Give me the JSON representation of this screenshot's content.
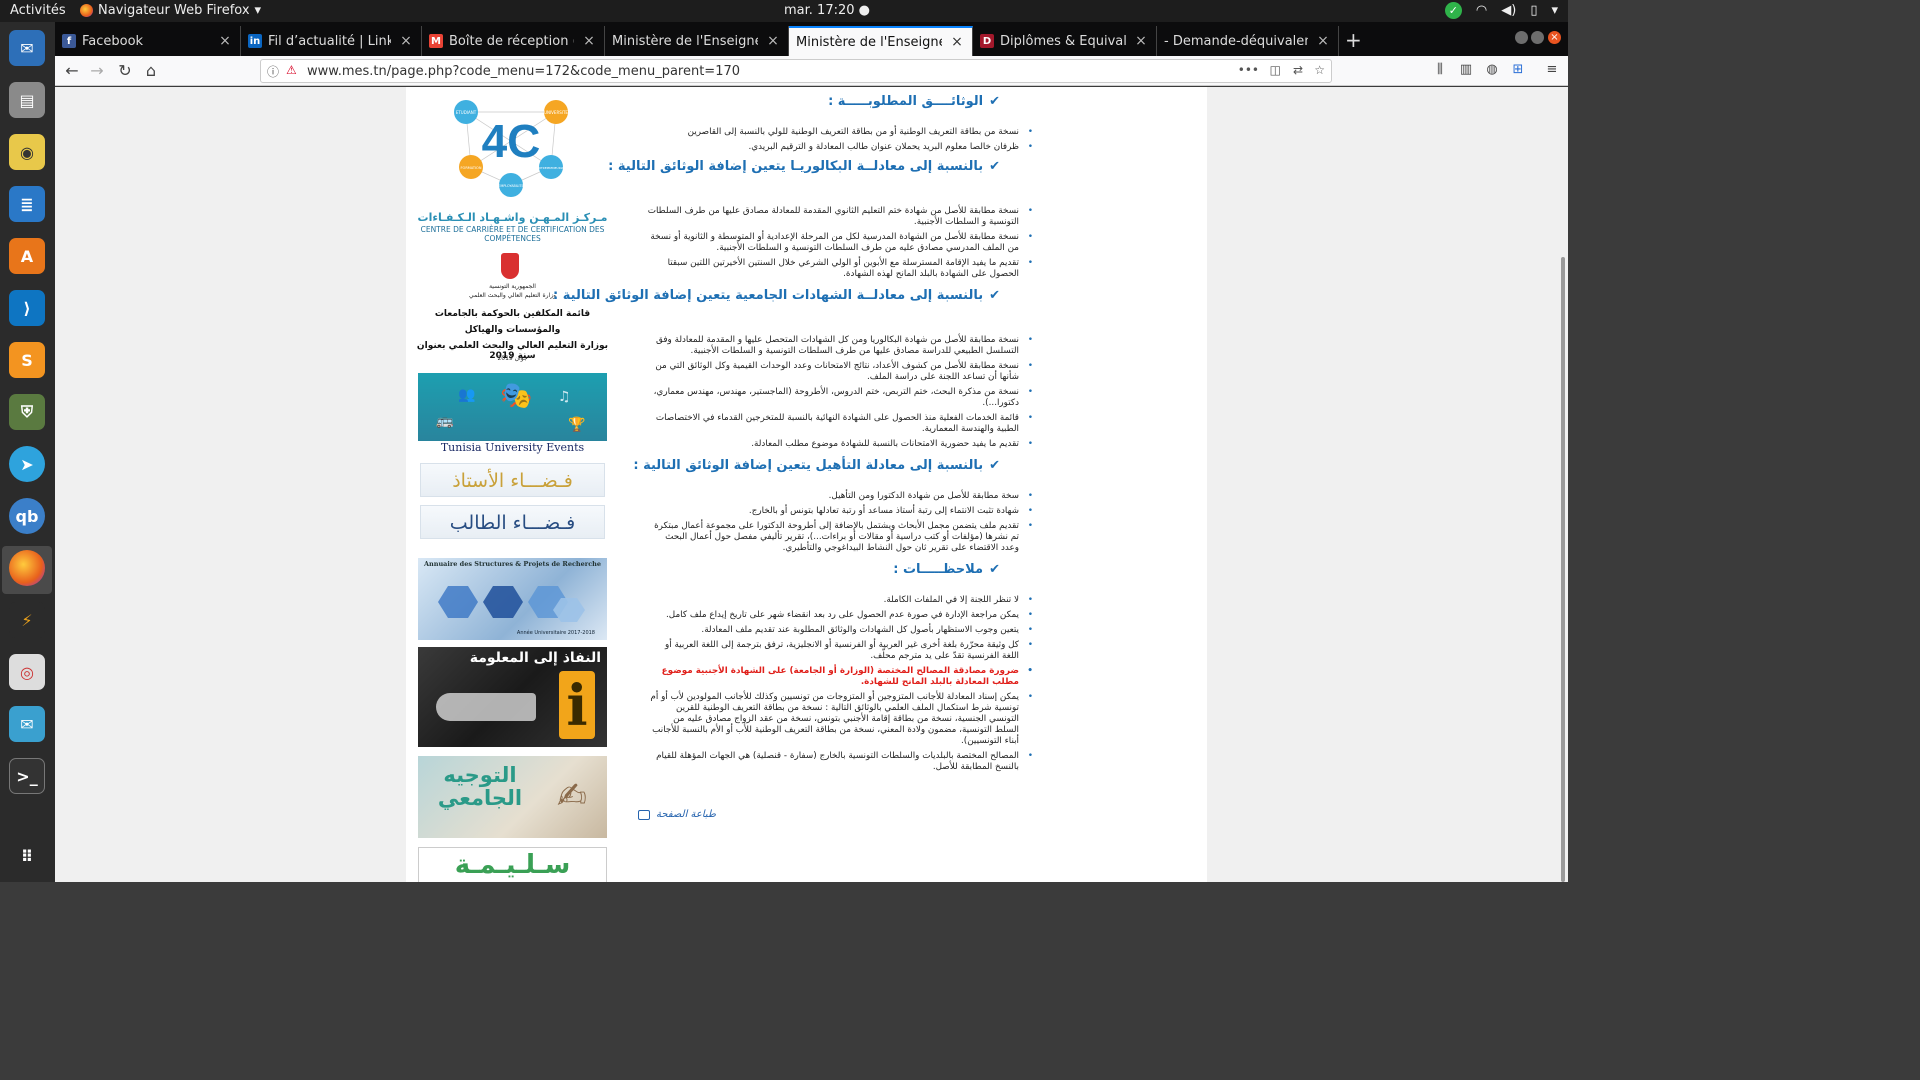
{
  "topbar": {
    "activities": "Activités",
    "app_name": "Navigateur Web Firefox",
    "clock": "mar. 17:20 ●"
  },
  "dock": {
    "items": [
      "thunderbird-icon",
      "files-icon",
      "rhythmbox-icon",
      "writer-icon",
      "software-icon",
      "vscode-icon",
      "sublime-icon",
      "app-icon",
      "telegram-icon",
      "qbittorrent-icon",
      "firefox-icon",
      "filezilla-icon",
      "evince-icon",
      "mail-icon",
      "terminal-icon",
      "apps-grid-icon"
    ]
  },
  "tabs": [
    {
      "label": "Facebook",
      "icon_color": "#3b5998",
      "icon_letter": "f"
    },
    {
      "label": "Fil d’actualité | LinkedIn",
      "icon_color": "#0a66c2",
      "icon_letter": "in"
    },
    {
      "label": "Boîte de réception (992)",
      "icon_color": "#ea4335",
      "icon_letter": "M"
    },
    {
      "label": "Ministère de l'Enseignement",
      "icon_color": "",
      "icon_letter": ""
    },
    {
      "label": "Ministère de l'Enseignement",
      "icon_color": "",
      "icon_letter": ""
    },
    {
      "label": "Diplômes & Equivalence",
      "icon_color": "#a3182b",
      "icon_letter": "D"
    },
    {
      "label": "- Demande-déquivalence-AR",
      "icon_color": "",
      "icon_letter": ""
    }
  ],
  "nav": {
    "url": "www.mes.tn/page.php?code_menu=172&code_menu_parent=170"
  },
  "sidebar": {
    "logo_text": "4C",
    "logo_labels": [
      "ETUDIANT",
      "UNIVERSITE",
      "ENTREPRENEURIAT",
      "EMPLOYABILITE",
      "FORMATION"
    ],
    "center_name_ar": "مـركـز المـهـن واشـهـاد الـكـفـاءات",
    "center_name_fr": "CENTRE DE CARRIÈRE ET DE CERTIFICATION DES COMPÉTENCES",
    "gov_line1": "الجمهورية التونسية",
    "gov_line2": "وزارة التعليم العالي والبحث العلمي",
    "list_line1": "قائمة المكلفين بالحوكمة بالجامعات",
    "list_line2": "والمؤسسات والهياكل",
    "list_line3": "بوزارة التعليم العالي والبحث العلمي بعنوان سنة 2019",
    "list_date": "جوان 2019",
    "events_caption": "Tunisia University Events",
    "prof_space": "فـضـــاء الأستاذ",
    "student_space": "فـضـــاء الطالب",
    "annuaire_title": "Annuaire des Structures & Projets de Recherche",
    "annuaire_year": "Année Universitaire 2017-2018",
    "access_text": "النفاذ إلى المعلومة",
    "access_i": "i",
    "orient_text": "التوجيه الجامعي",
    "salima_text": "سـلـيـمـة"
  },
  "content": {
    "sections": [
      {
        "title": "الوثائــــق المطلوبـــــة :",
        "items": [
          "نسخة من بطاقة التعريف الوطنية أو من بطاقة التعريف الوطنية للولي بالنسبة إلى القاصرين",
          "ظرفان خالصا معلوم البريد يحملان عنوان طالب المعادلة و الترقيم البريدي."
        ]
      },
      {
        "title": "بالنسبة إلى معادلــة البكالوريـا يتعين إضافة الوثائق التالية :",
        "items": [
          "نسخة مطابقة للأصل من شهادة ختم التعليم الثانوي المقدمة للمعادلة مصادق عليها من طرف السلطات التونسية و السلطات الأجنبية.",
          "نسخة مطابقة للأصل من الشهادة المدرسية لكل من المرحلة الإعدادية أو المتوسطة و الثانوية أو نسخة من الملف المدرسي  مصادق عليه من طرف السلطات التونسية و السلطات الأجنبية.",
          "تقديم ما يفيد الإقامة المسترسلة مع الأبوين أو الولي الشرعي خلال السنتين الأخيرتين اللتين سبقتا الحصول على الشهادة بالبلد المانح لهذه الشهادة."
        ]
      },
      {
        "title": "بالنسبة إلى معادلــة الشهادات الجامعية يتعين إضافة الوثائق التالية :",
        "items": [
          "نسخة مطابقة للأصل من شهادة  البكالوريا ومن كل الشهادات المتحصل عليها و المقدمة للمعادلة وفق التسلسل الطبيعي للدراسة  مصادق عليها من طرف السلطات التونسية و السلطات الأجنبية.",
          "نسخة مطابقة للأصل من كشوف الأعداد، نتائج الامتحانات وعدد الوحدات القيمية وكل الوثائق التي من شأنها أن تساعد اللجنة على دراسة الملف.",
          "نسخة من مذكرة  البحث، ختم التربص، ختم الدروس، الأطروحة (الماجستير، مهندس، مهندس معماري، دكتورا...).",
          "قائمة الخدمات الفعلية منذ الحصول على الشهادة النهائية بالنسبة للمتخرجين القدماء في الاختصاصات الطبية والهندسة المعمارية.",
          "تقديم ما يفيد حضورية الامتحانات بالنسبة للشهادة موضوع مطلب المعادلة."
        ]
      },
      {
        "title": "بالنسبة إلى معادلة التأهيل يتعين إضافة الوثائق التالية :",
        "items": [
          "سخة مطابقة للأصل من شهادة الدكتورا ومن التأهيل.",
          "شهادة تثبت الانتماء إلى رتبة أستاذ مساعد أو رتبة تعادلها بتونس أو بالخارج.",
          "تقديم ملف يتضمن مجمل الأبحاث ويشتمل بالإضافة إلى أطروحة الدكتورا على مجموعة أعمال مبتكرة تم نشرها (مؤلفات أو كتب دراسية أو مقالات أو براءات...)، تقرير تأليفي مفصل حول أعمال البحث وعدد الاقتضاء على تقرير ثان حول النشاط البيداغوجي والتأطيري."
        ]
      },
      {
        "title": "ملاحظـــــات :",
        "items": [
          "لا تنظر اللجنة إلا في الملفات الكاملة.",
          "يمكن مراجعة الإدارة في صورة عدم الحصول على رد بعد انقضاء شهر على تاريخ إيداع ملف كامل.",
          "يتعين وجوب الاستظهار بأصول كل  الشهادات والوثائق المطلوبة عند تقديم ملف المعادلة.",
          "كل وثيقة محرّرة بلغة أخرى غير العربية أو الفرنسية أو الانجليزية، ترفق بترجمة إلى اللغة العربية أو اللغة الفرنسية تقدّ على يد مترجم محلّف.",
          "ضرورة مصادقة المصالح المختصة (الوزارة أو الجامعة) على الشهادة الأجنبية موضوع مطلب المعادلة بالبلد المانح للشهادة.",
          "يمكن إسناد المعادلة للأجانب المتزوجين أو المتزوجات من تونسيين وكذلك للأجانب المولودين لأب أو أم تونسية شرط استكمال الملف العلمي بالوثائق التالية : نسخة من بطاقة التعريف الوطنية للقرين التونسي الجنسية، نسخة من بطاقة إقامة الأجنبي بتونس، نسخة من عقد الزواج مصادق عليه من السلط التونسية، مضمون ولادة المعني، نسخة من بطاقة التعريف الوطنية للأب أو الأم بالنسبة للأجانب أبناء التونسيين).",
          "المصالح المختصة بالبلديات والسلطات التونسية بالخارج (سفارة - قنصلية) هي الجهات المؤهلة للقيام بالنسخ المطابقة للأصل."
        ],
        "red_index": 4
      }
    ],
    "print_label": "طباعة الصفحة"
  }
}
